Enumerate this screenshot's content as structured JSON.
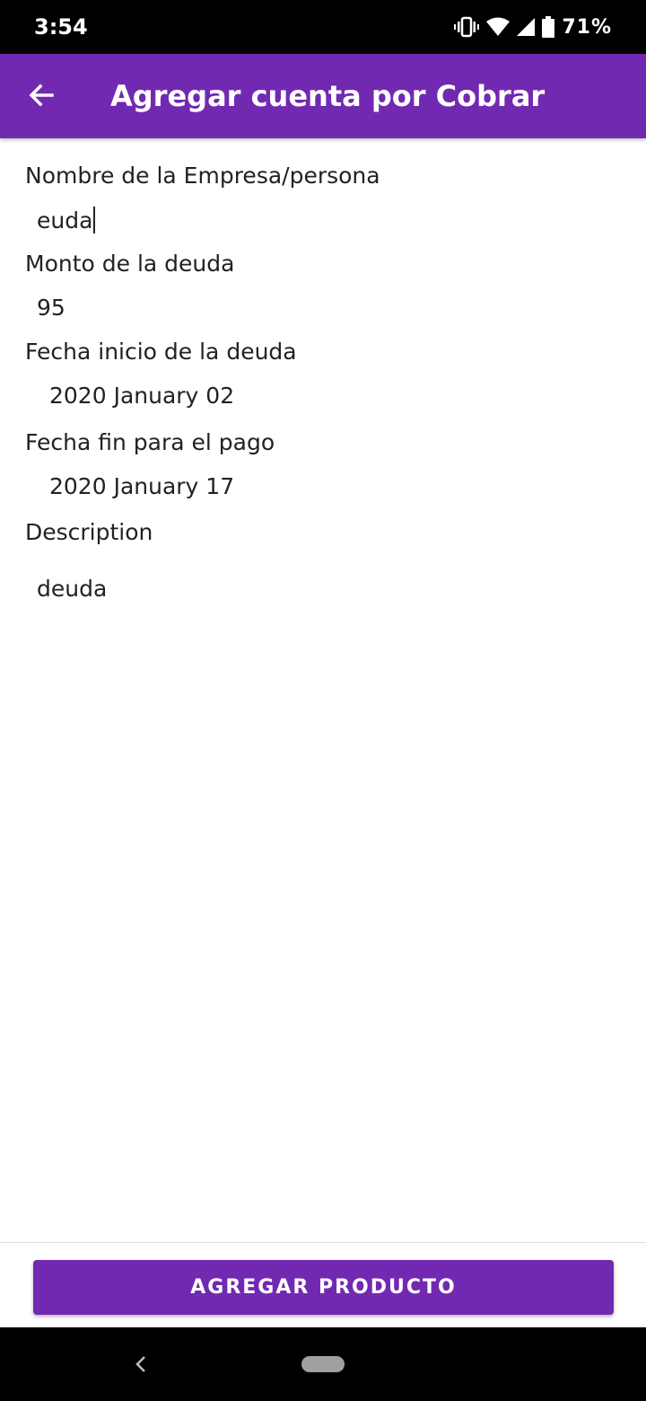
{
  "status_bar": {
    "time": "3:54",
    "battery": "71%",
    "icons": [
      "vibrate-icon",
      "wifi-icon",
      "signal-icon",
      "battery-icon"
    ]
  },
  "app_bar": {
    "title": "Agregar cuenta por Cobrar",
    "back_icon": "arrow-left-icon",
    "color": "#7229b2"
  },
  "form": {
    "company_label": "Nombre de la Empresa/persona",
    "company_value": "euda",
    "amount_label": "Monto de la deuda",
    "amount_value": "95",
    "start_date_label": "Fecha inicio de la deuda",
    "start_date_value": "2020 January 02",
    "end_date_label": "Fecha fin para el pago",
    "end_date_value": "2020 January 17",
    "description_label": "Description",
    "description_value": "deuda"
  },
  "actions": {
    "add_label": "AGREGAR PRODUCTO"
  },
  "nav_bar": {
    "back_icon": "nav-back-icon",
    "home_icon": "home-pill-icon"
  }
}
